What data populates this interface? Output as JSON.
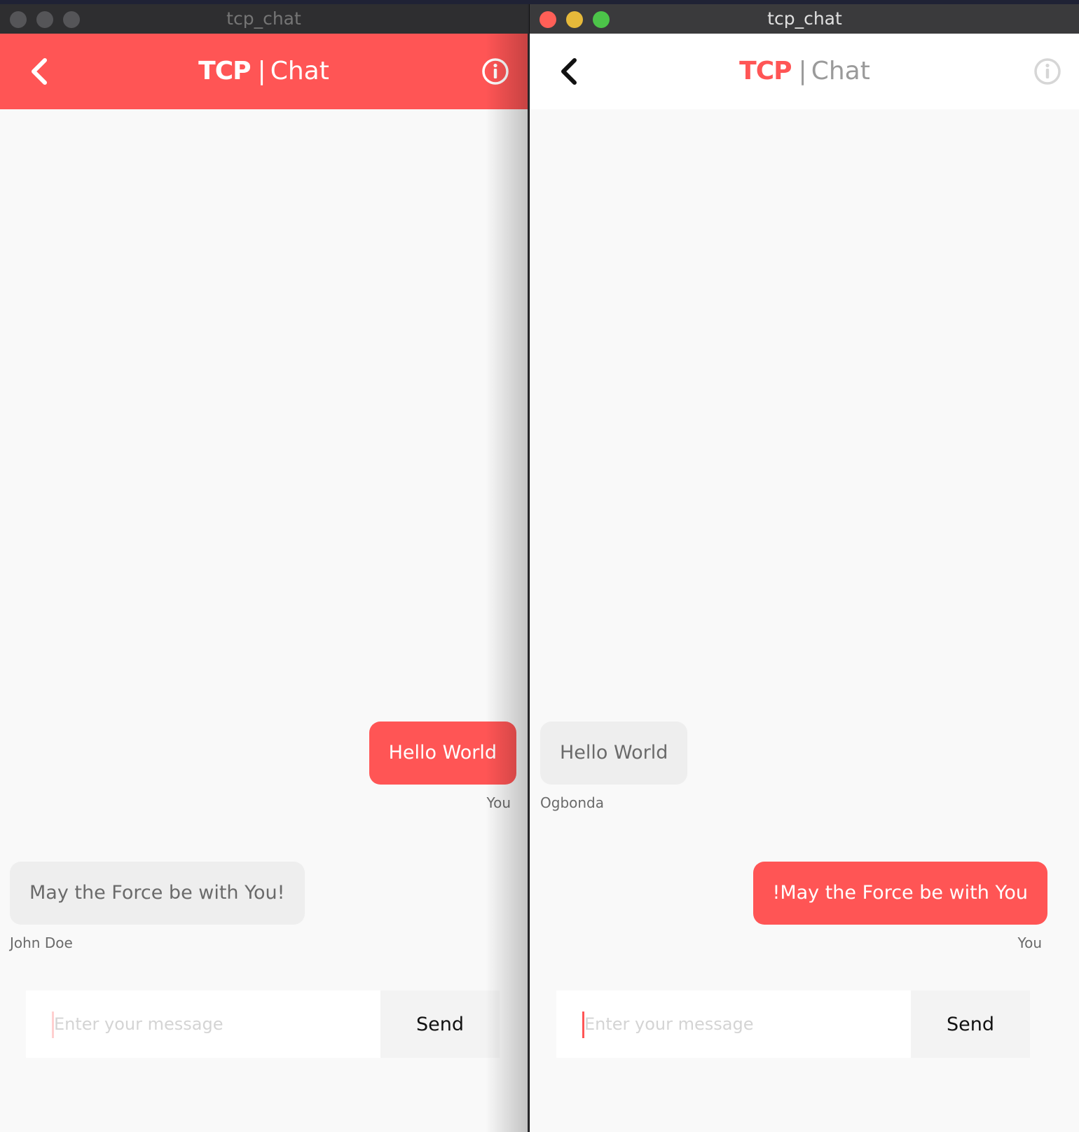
{
  "colors": {
    "accent": "#ff5555",
    "received_bubble": "#eeeeee",
    "traffic_inactive": "#555558",
    "traffic_close": "#ff5f57",
    "traffic_min": "#febc2e",
    "traffic_max": "#28c840"
  },
  "windows": [
    {
      "window_title": "tcp_chat",
      "active": false,
      "header": {
        "brand": "TCP",
        "separator": "|",
        "subtitle": "Chat",
        "back_icon": "chevron-left-icon",
        "info_icon": "info-circle-icon"
      },
      "messages": [
        {
          "text": "Hello World",
          "sender": "You",
          "direction": "sent"
        },
        {
          "text": "May the Force be with You!",
          "sender": "John Doe",
          "direction": "received"
        }
      ],
      "composer": {
        "placeholder": "Enter your message",
        "send_label": "Send"
      }
    },
    {
      "window_title": "tcp_chat",
      "active": true,
      "header": {
        "brand": "TCP",
        "separator": "|",
        "subtitle": "Chat",
        "back_icon": "chevron-left-icon",
        "info_icon": "info-circle-icon"
      },
      "messages": [
        {
          "text": "Hello World",
          "sender": "Ogbonda",
          "direction": "received"
        },
        {
          "text": "!May the Force be with You",
          "sender": "You",
          "direction": "sent"
        }
      ],
      "composer": {
        "placeholder": "Enter your message",
        "send_label": "Send"
      }
    }
  ]
}
